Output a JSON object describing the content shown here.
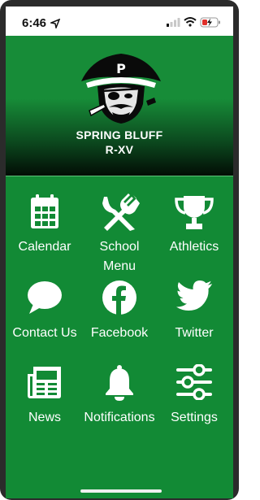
{
  "status_bar": {
    "time": "6:46"
  },
  "header": {
    "school_name_line1": "SPRING BLUFF",
    "school_name_line2": "R-XV",
    "logo_letter": "P"
  },
  "menu": [
    {
      "label": "Calendar",
      "icon": "calendar-icon"
    },
    {
      "label": "School\nMenu",
      "icon": "fork-knife-icon"
    },
    {
      "label": "Athletics",
      "icon": "trophy-icon"
    },
    {
      "label": "Contact Us",
      "icon": "chat-bubble-icon"
    },
    {
      "label": "Facebook",
      "icon": "facebook-icon"
    },
    {
      "label": "Twitter",
      "icon": "twitter-icon"
    },
    {
      "label": "News",
      "icon": "newspaper-icon"
    },
    {
      "label": "Notifications",
      "icon": "bell-icon"
    },
    {
      "label": "Settings",
      "icon": "sliders-icon"
    }
  ],
  "colors": {
    "background": "#128a35",
    "header_dark": "#020d05",
    "text": "#ffffff"
  }
}
